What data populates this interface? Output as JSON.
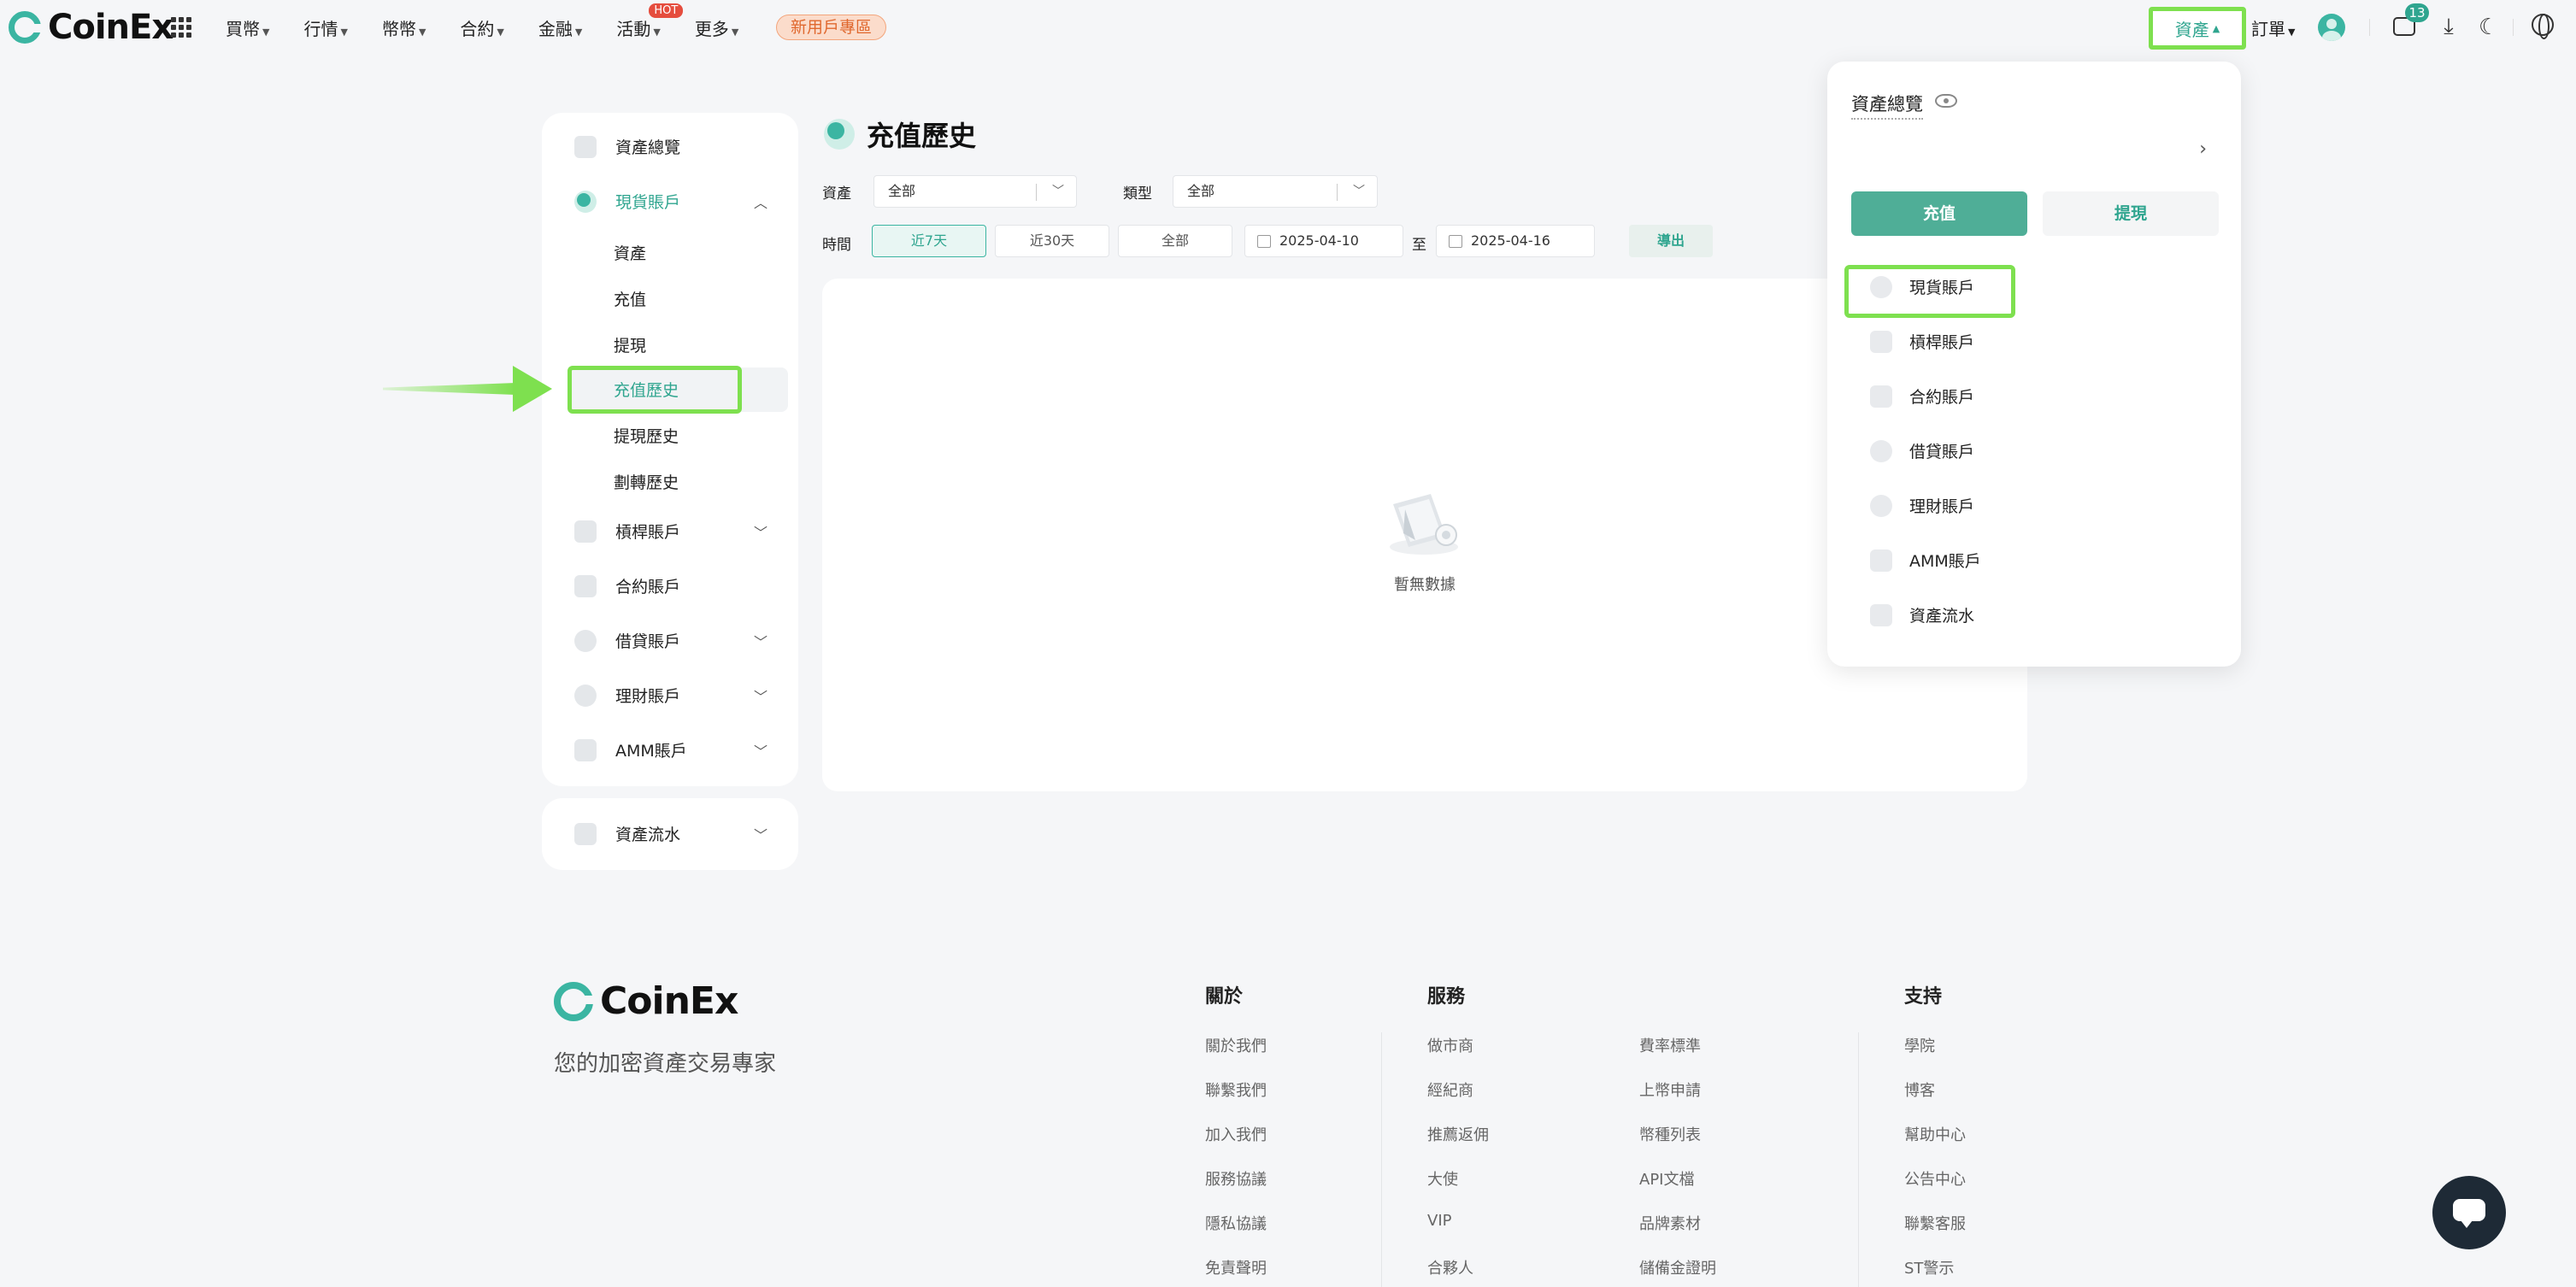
{
  "brand": {
    "name": "CoinEx",
    "accent": "#3bb5a2",
    "highlight": "#7ee04f"
  },
  "nav": {
    "items": [
      {
        "label": "買幣"
      },
      {
        "label": "行情"
      },
      {
        "label": "幣幣"
      },
      {
        "label": "合約"
      },
      {
        "label": "金融"
      },
      {
        "label": "活動",
        "badge": "HOT"
      },
      {
        "label": "更多"
      }
    ],
    "promo": "新用戶專區",
    "assets": "資產",
    "orders": "訂單",
    "message_count": "13",
    "icons": [
      "apps-grid-icon",
      "message-icon",
      "download-icon",
      "moon-icon",
      "globe-icon"
    ]
  },
  "sidebar": {
    "overview": "資產總覽",
    "spot": {
      "label": "現貨賬戶",
      "children": [
        "資產",
        "充值",
        "提現",
        "充值歷史",
        "提現歷史",
        "劃轉歷史"
      ],
      "active": "充值歷史"
    },
    "margin": "槓桿賬戶",
    "futures": "合約賬戶",
    "loan": "借貸賬戶",
    "finance": "理財賬戶",
    "amm": "AMM賬戶",
    "ledger": "資產流水"
  },
  "page": {
    "title": "充值歷史",
    "filters": {
      "asset_label": "資產",
      "asset_value": "全部",
      "type_label": "類型",
      "type_value": "全部",
      "time_label": "時間",
      "time_options": [
        "近7天",
        "近30天",
        "全部"
      ],
      "time_selected": "近7天",
      "date_from": "2025-04-10",
      "date_to_label": "至",
      "date_to": "2025-04-16",
      "export": "導出"
    },
    "empty": "暫無數據"
  },
  "dropdown": {
    "title": "資產總覽",
    "deposit": "充值",
    "withdraw": "提現",
    "items": [
      "現貨賬戶",
      "槓桿賬戶",
      "合約賬戶",
      "借貸賬戶",
      "理財賬戶",
      "AMM賬戶",
      "資產流水"
    ]
  },
  "footer": {
    "slogan": "您的加密資產交易專家",
    "about": {
      "title": "關於",
      "links": [
        "關於我們",
        "聯繫我們",
        "加入我們",
        "服務協議",
        "隱私協議",
        "免責聲明"
      ]
    },
    "services": {
      "title": "服務",
      "col1": [
        "做市商",
        "經紀商",
        "推薦返佣",
        "大使",
        "VIP",
        "合夥人"
      ],
      "col2": [
        "費率標準",
        "上幣申請",
        "幣種列表",
        "API文檔",
        "品牌素材",
        "儲備金證明"
      ]
    },
    "support": {
      "title": "支持",
      "links": [
        "學院",
        "博客",
        "幫助中心",
        "公告中心",
        "聯繫客服",
        "ST警示"
      ]
    }
  }
}
